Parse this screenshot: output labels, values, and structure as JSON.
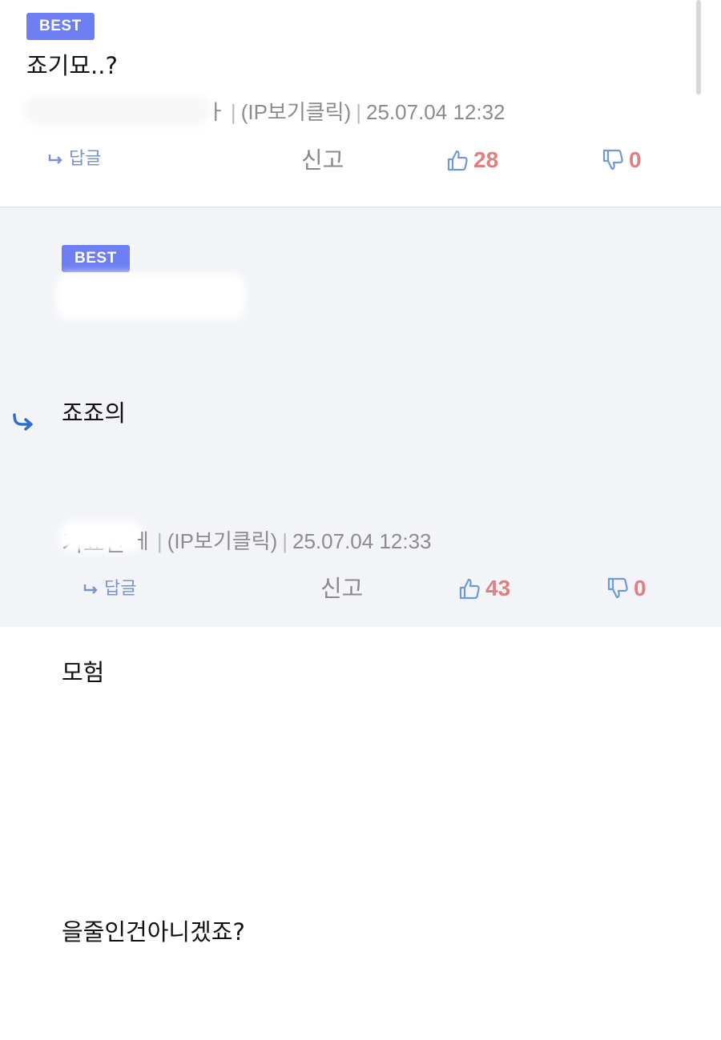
{
  "comments": [
    {
      "badge": "BEST",
      "lines": [
        "죠기묘..?"
      ],
      "meta_ip": "(IP보기클릭)",
      "meta_time": "25.07.04 12:32",
      "author_tail": "ㅏ",
      "reply_label": "답글",
      "report_label": "신고",
      "likes": "28",
      "dislikes": "0"
    },
    {
      "badge": "BEST",
      "lines": [
        "죠죠의",
        "기묘한",
        "모험",
        "",
        "을줄인건아니겠죠?"
      ],
      "meta_ip": "(IP보기클릭)",
      "meta_time": "25.07.04 12:33",
      "author_tail": "ㅔ",
      "reply_label": "답글",
      "report_label": "신고",
      "likes": "43",
      "dislikes": "0"
    }
  ],
  "colors": {
    "badge": "#6d7ff2",
    "vote_count": "#e07f7f",
    "icon": "#6f9ad8",
    "reply_arrow": "#2e6fd1"
  },
  "icons": {
    "reply": "reply-arrow-icon",
    "like": "thumbs-up-icon",
    "dislike": "thumbs-down-icon",
    "nested": "nested-reply-arrow-icon"
  }
}
